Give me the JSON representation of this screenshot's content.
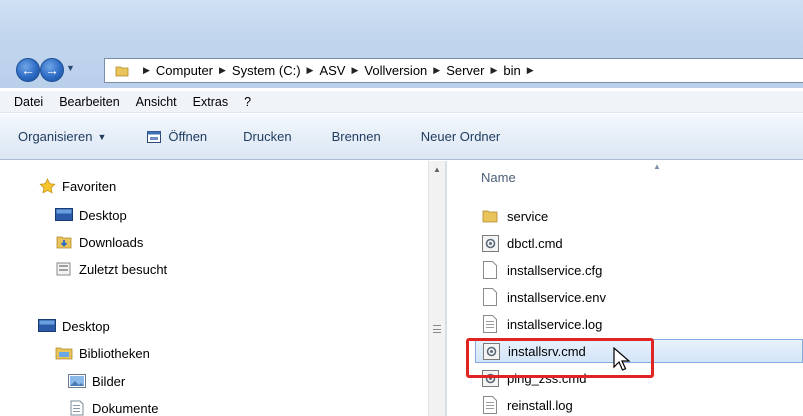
{
  "address_bar": {
    "crumbs": [
      "Computer",
      "System (C:)",
      "ASV",
      "Vollversion",
      "Server",
      "bin"
    ]
  },
  "menu": [
    "Datei",
    "Bearbeiten",
    "Ansicht",
    "Extras",
    "?"
  ],
  "commands": {
    "organize": "Organisieren",
    "open": "Öffnen",
    "print": "Drucken",
    "burn": "Brennen",
    "new_folder": "Neuer Ordner"
  },
  "nav_pane": {
    "favorites": "Favoriten",
    "fav_items": [
      "Desktop",
      "Downloads",
      "Zuletzt besucht"
    ],
    "desktop": "Desktop",
    "libraries": "Bibliotheken",
    "lib_items": [
      "Bilder",
      "Dokumente"
    ]
  },
  "file_list": {
    "column_name": "Name",
    "files": [
      {
        "name": "service",
        "type": "folder"
      },
      {
        "name": "dbctl.cmd",
        "type": "cmd"
      },
      {
        "name": "installservice.cfg",
        "type": "file"
      },
      {
        "name": "installservice.env",
        "type": "file"
      },
      {
        "name": "installservice.log",
        "type": "log"
      },
      {
        "name": "installsrv.cmd",
        "type": "cmd",
        "selected": true
      },
      {
        "name": "ping_zss.cmd",
        "type": "cmd"
      },
      {
        "name": "reinstall.log",
        "type": "log"
      }
    ]
  },
  "colors": {
    "highlight": "#e02424",
    "selection": "#d3e5f9"
  }
}
